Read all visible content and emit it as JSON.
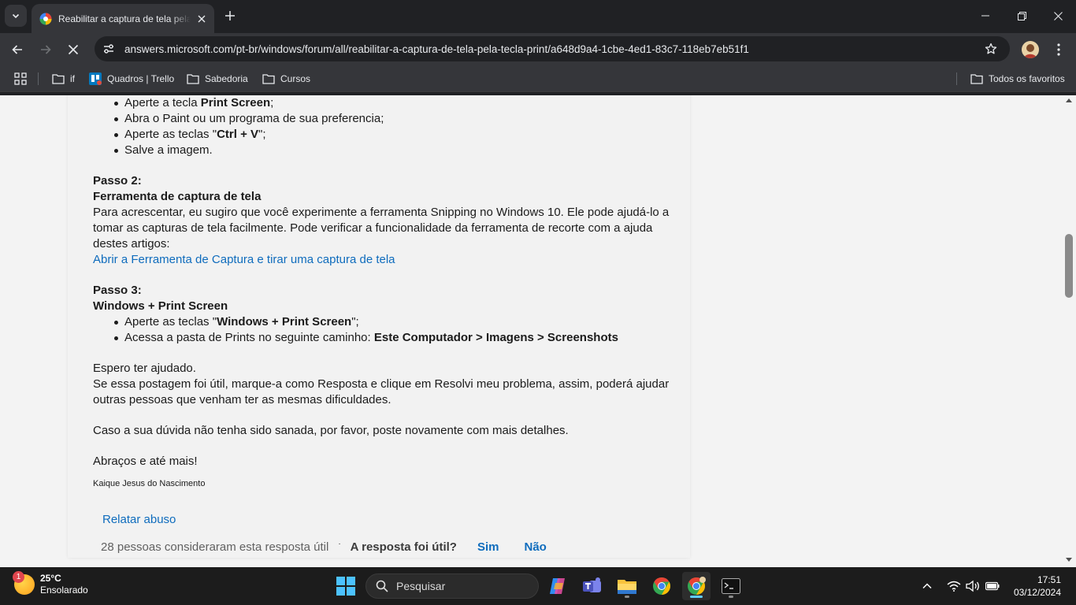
{
  "browser": {
    "tab": {
      "title": "Reabilitar a captura de tela pela tecla Print"
    },
    "omnibox": {
      "url": "answers.microsoft.com/pt-br/windows/forum/all/reabilitar-a-captura-de-tela-pela-tecla-print/a648d9a4-1cbe-4ed1-83c7-118eb7eb51f1"
    },
    "bookmarks": {
      "items": [
        "if",
        "Quadros | Trello",
        "Sabedoria",
        "Cursos"
      ],
      "all_favorites": "Todos os favoritos"
    }
  },
  "article": {
    "step1_list": [
      {
        "pre": "Aperte a tecla ",
        "bold": "Print Screen",
        "post": ";"
      },
      {
        "pre": "Abra o Paint ou um programa de sua preferencia;",
        "bold": "",
        "post": ""
      },
      {
        "pre": "Aperte as teclas \"",
        "bold": "Ctrl + V",
        "post": "\";"
      },
      {
        "pre": "Salve a imagem.",
        "bold": "",
        "post": ""
      }
    ],
    "step2_heading": "Passo 2:",
    "step2_subheading": "Ferramenta de captura de tela",
    "step2_text": "Para acrescentar, eu sugiro que você experimente a ferramenta Snipping no Windows 10. Ele pode ajudá-lo a tomar as capturas de tela facilmente. Pode verificar a funcionalidade da ferramenta de recorte com a ajuda destes artigos:",
    "step2_link": "Abrir a Ferramenta de Captura e tirar uma captura de tela",
    "step3_heading": "Passo 3:",
    "step3_subheading": "Windows + Print Screen",
    "step3_item1_pre": "Aperte as teclas \"",
    "step3_item1_bold": "Windows + Print Screen",
    "step3_item1_post": "\";",
    "step3_item2_pre": "Acessa a pasta de Prints no seguinte caminho: ",
    "step3_item2_bold": "Este Computador > Imagens > Screenshots",
    "closing1": "Espero ter ajudado.",
    "closing2": "Se essa postagem foi útil, marque-a como Resposta e clique em Resolvi meu problema, assim, poderá ajudar outras pessoas que venham ter as mesmas dificuldades.",
    "closing3": "Caso a sua dúvida não tenha sido sanada, por favor, poste novamente com mais detalhes.",
    "closing4": "Abraços e até mais!",
    "signature": "Kaique Jesus do Nascimento",
    "report_abuse": "Relatar abuso",
    "helpful_count": "28 pessoas consideraram esta resposta útil",
    "helpful_dot": "·",
    "helpful_question": "A resposta foi útil?",
    "yes": "Sim",
    "no": "Não"
  },
  "taskbar": {
    "weather_badge": "1",
    "temperature": "25°C",
    "condition": "Ensolarado",
    "search_placeholder": "Pesquisar",
    "time": "17:51",
    "date": "03/12/2024"
  }
}
